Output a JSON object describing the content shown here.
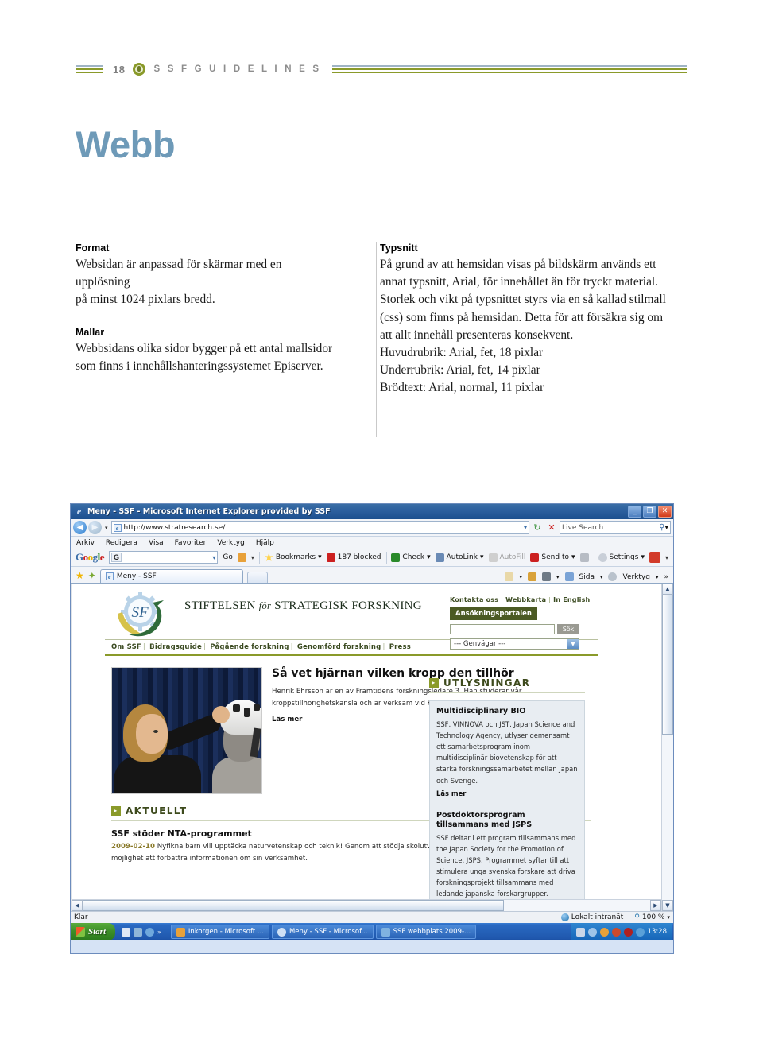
{
  "page": {
    "number": "18",
    "running_head": "S S F  G U I D E L I N E S",
    "title": "Webb"
  },
  "columns": {
    "left": [
      {
        "heading": "Format",
        "lines": [
          "Websidan är anpassad för skärmar med en upplösning",
          "på minst 1024 pixlars bredd."
        ]
      },
      {
        "heading": "Mallar",
        "lines": [
          "Webbsidans olika sidor bygger på ett antal mallsidor",
          "som finns i innehållshanteringssystemet Episerver."
        ]
      }
    ],
    "right": [
      {
        "heading": "Typsnitt",
        "lines": [
          "På grund av att hemsidan visas på bildskärm används ett",
          "annat typsnitt, Arial, för innehållet än för tryckt material.",
          "Storlek och vikt på typsnittet styrs via en så kallad stilmall",
          "(css) som finns på hemsidan. Detta för att försäkra sig om",
          "att allt innehåll presenteras konsekvent.",
          "Huvudrubrik: Arial, fet, 18 pixlar",
          "Underrubrik: Arial, fet, 14 pixlar",
          "Brödtext: Arial, normal, 11 pixlar"
        ]
      }
    ]
  },
  "browser": {
    "window_title": "Meny - SSF - Microsoft Internet Explorer provided by SSF",
    "window_buttons": {
      "minimize": "_",
      "restore": "❐",
      "close": "✕"
    },
    "address": {
      "url": "http://www.stratresearch.se/",
      "dropdown_icon": "▾",
      "refresh_icon": "↻",
      "stop_icon": "✕",
      "search_placeholder": "Live Search",
      "search_icon": "🔍",
      "back_icon": "◀",
      "forward_icon": "▶"
    },
    "menu": [
      "Arkiv",
      "Redigera",
      "Visa",
      "Favoriter",
      "Verktyg",
      "Hjälp"
    ],
    "google_toolbar": {
      "logo": "Google",
      "box_badge": "G",
      "box_caret": "▾",
      "go": "Go",
      "items": [
        {
          "label": "Bookmarks",
          "caret": "▾",
          "color": "#3b6ea8"
        },
        {
          "label": "187 blocked",
          "caret": "",
          "color": "#cc2020"
        },
        {
          "label": "Check",
          "caret": "▾",
          "color": "#2a8a2a"
        },
        {
          "label": "AutoLink",
          "caret": "▾",
          "color": "#6a6a6a"
        },
        {
          "label": "AutoFill",
          "caret": "",
          "color": "#b5b5b5"
        },
        {
          "label": "Send to",
          "caret": "▾",
          "color": "#cc2020"
        }
      ],
      "settings": "Settings",
      "settings_caret": "▾"
    },
    "tabbar": {
      "tab_label": "Meny - SSF",
      "buttons": [
        {
          "label": "Sida",
          "caret": "▾"
        },
        {
          "label": "Verktyg",
          "caret": "▾"
        }
      ],
      "overflow": "»"
    },
    "statusbar": {
      "status": "Klar",
      "zone": "Lokalt intranät",
      "zoom": "100 %",
      "zoom_caret": "▾"
    },
    "taskbar": {
      "start": "Start",
      "overflow": "»",
      "tasks": [
        "Inkorgen - Microsoft ...",
        "Meny - SSF - Microsof...",
        "SSF webbplats 2009-..."
      ],
      "clock": "13:28"
    }
  },
  "site": {
    "wordmark": {
      "part1": "STIFTELSEN",
      "part2": "för",
      "part3": "STRATEGISK",
      "part4": "FORSKNING"
    },
    "top_links": [
      "Kontakta oss",
      "Webbkarta",
      "In English"
    ],
    "portal_button": "Ansökningsportalen",
    "search_button": "Sök",
    "shortcut_select": "--- Genvägar ---",
    "main_nav": [
      "Om SSF",
      "Bidragsguide",
      "Pågående forskning",
      "Genomförd forskning",
      "Press"
    ],
    "hero": {
      "heading": "Så vet hjärnan vilken kropp den tillhör",
      "body": "Henrik Ehrsson är en av Framtidens forskningsledare 3. Han studerar vår kroppstillhörighetskänsla och är verksam vid Karolinska Institutet.",
      "read_more": "Läs mer",
      "image_alt": "Forskare placerar vit hjälm på skyltdocka"
    },
    "aktuellt": {
      "section_title": "AKTUELLT",
      "badge": "▸",
      "heading": "SSF stöder NTA-programmet",
      "date": "2009-02-10",
      "body": "Nyfikna barn vill upptäcka naturvetenskap och teknik! Genom att stödja skolutvecklingsprogrammet NTA vill SSF ge NTA möjlighet att förbättra informationen om sin verksamhet."
    },
    "utlysningar": {
      "section_title": "UTLYSNINGAR",
      "badge": "▸",
      "items": [
        {
          "heading": "Multidisciplinary BIO",
          "body": "SSF, VINNOVA och JST, Japan Science and Technology Agency, utlyser gemensamt ett samarbetsprogram inom multidisciplinär biovetenskap för att stärka forskningssamarbetet mellan Japan och Sverige.",
          "read_more": "Läs mer"
        },
        {
          "heading": "Postdoktorsprogram tillsammans med JSPS",
          "body": "SSF deltar i ett program tillsammans med the Japan Society for the Promotion of Science, JSPS. Programmet syftar till att stimulera unga svenska forskare att driva forskningsprojekt tillsammans med ledande japanska forskargrupper.",
          "read_more": ""
        }
      ]
    }
  },
  "colors": {
    "title_blue": "#6e9ab8",
    "rule_olive": "#8a9a2a",
    "rule_steel": "#9fb4c4",
    "site_green": "#4b5a23",
    "heading_gray": "#8d8d8d"
  }
}
